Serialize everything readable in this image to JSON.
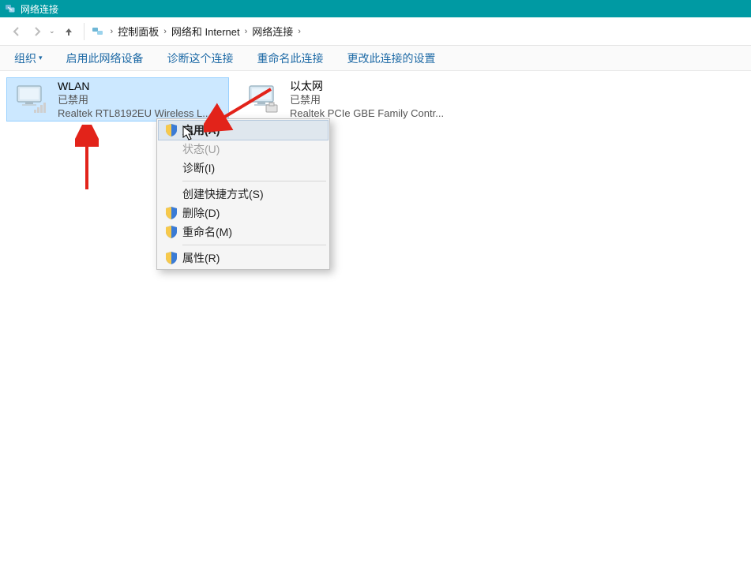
{
  "window": {
    "title": "网络连接"
  },
  "breadcrumb": {
    "path0": "控制面板",
    "path1": "网络和 Internet",
    "path2": "网络连接",
    "sep": "›"
  },
  "toolbar": {
    "org_label": "组织",
    "enable_label": "启用此网络设备",
    "diag_label": "诊断这个连接",
    "rename_label": "重命名此连接",
    "settings_label": "更改此连接的设置"
  },
  "adapters": [
    {
      "name": "WLAN",
      "status": "已禁用",
      "desc": "Realtek RTL8192EU Wireless L..."
    },
    {
      "name": "以太网",
      "status": "已禁用",
      "desc": "Realtek PCIe GBE Family Contr..."
    }
  ],
  "menu": {
    "enable": "启用(A)",
    "status": "状态(U)",
    "diag": "诊断(I)",
    "shortcut": "创建快捷方式(S)",
    "delete": "删除(D)",
    "rename": "重命名(M)",
    "props": "属性(R)"
  },
  "colors": {
    "accent_teal": "#009aa3",
    "select_bg": "#cce8ff",
    "link": "#1e6aa6",
    "arrow_red": "#e2231a"
  }
}
